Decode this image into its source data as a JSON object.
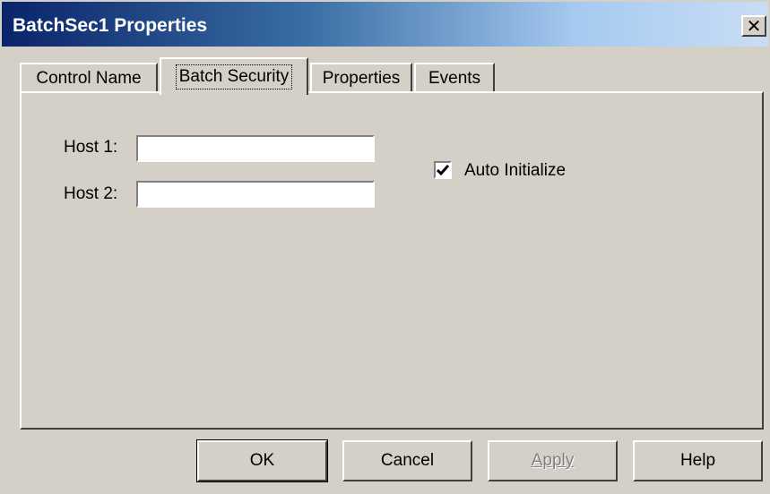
{
  "window": {
    "title": "BatchSec1 Properties",
    "close_glyph": "✕"
  },
  "tabs": [
    {
      "label": "Control Name",
      "active": false
    },
    {
      "label": "Batch Security",
      "active": true
    },
    {
      "label": "Properties",
      "active": false
    },
    {
      "label": "Events",
      "active": false
    }
  ],
  "form": {
    "host1_label": "Host 1:",
    "host1_value": "",
    "host2_label": "Host 2:",
    "host2_value": "",
    "auto_init_label": "Auto Initialize",
    "auto_init_checked": true
  },
  "buttons": {
    "ok": "OK",
    "cancel": "Cancel",
    "apply": "Apply",
    "help": "Help"
  },
  "colors": {
    "face": "#d4d0c8",
    "title_start": "#0a246a",
    "title_end": "#a6caf0"
  }
}
